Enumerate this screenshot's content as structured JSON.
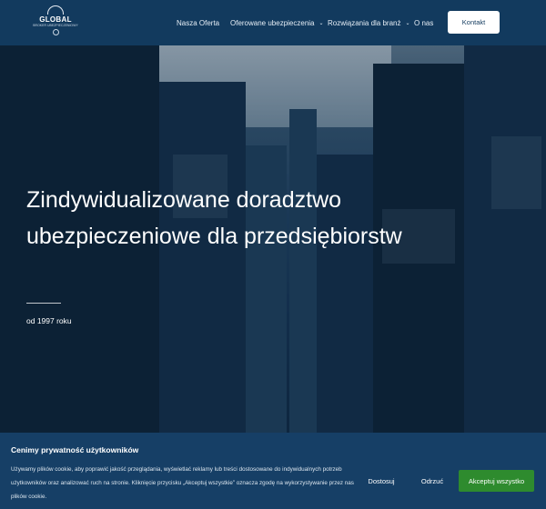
{
  "header": {
    "logo": {
      "word": "GLOBAL",
      "subline": "BROKER UBEZPIECZENIOWY"
    },
    "nav": [
      {
        "label": "Nasza Oferta",
        "has_dropdown": false
      },
      {
        "label": "Oferowane ubezpieczenia",
        "has_dropdown": true
      },
      {
        "label": "Rozwiązania dla branż",
        "has_dropdown": true
      },
      {
        "label": "O nas",
        "has_dropdown": false
      }
    ],
    "contact_label": "Kontakt",
    "chevron": "⌄"
  },
  "hero": {
    "title": "Zindywidualizowane doradztwo ubezpieczeniowe dla przedsiębiorstw",
    "since": "od 1997 roku"
  },
  "cookie": {
    "title": "Cenimy prywatność użytkowników",
    "text": "Używamy plików cookie, aby poprawić jakość przeglądania, wyświetlać reklamy lub treści dostosowane do indywidualnych potrzeb użytkowników oraz analizować ruch na stronie. Kliknięcie przycisku „Akceptuj wszystkie” oznacza zgodę na wykorzystywanie przez nas plików cookie.",
    "settings_label": "Dostosuj",
    "reject_label": "Odrzuć",
    "accept_label": "Akceptuj wszystko"
  },
  "colors": {
    "header_bg": "#123a5e",
    "cookie_bg": "#163f66",
    "accept_green": "#2e8b2e"
  }
}
